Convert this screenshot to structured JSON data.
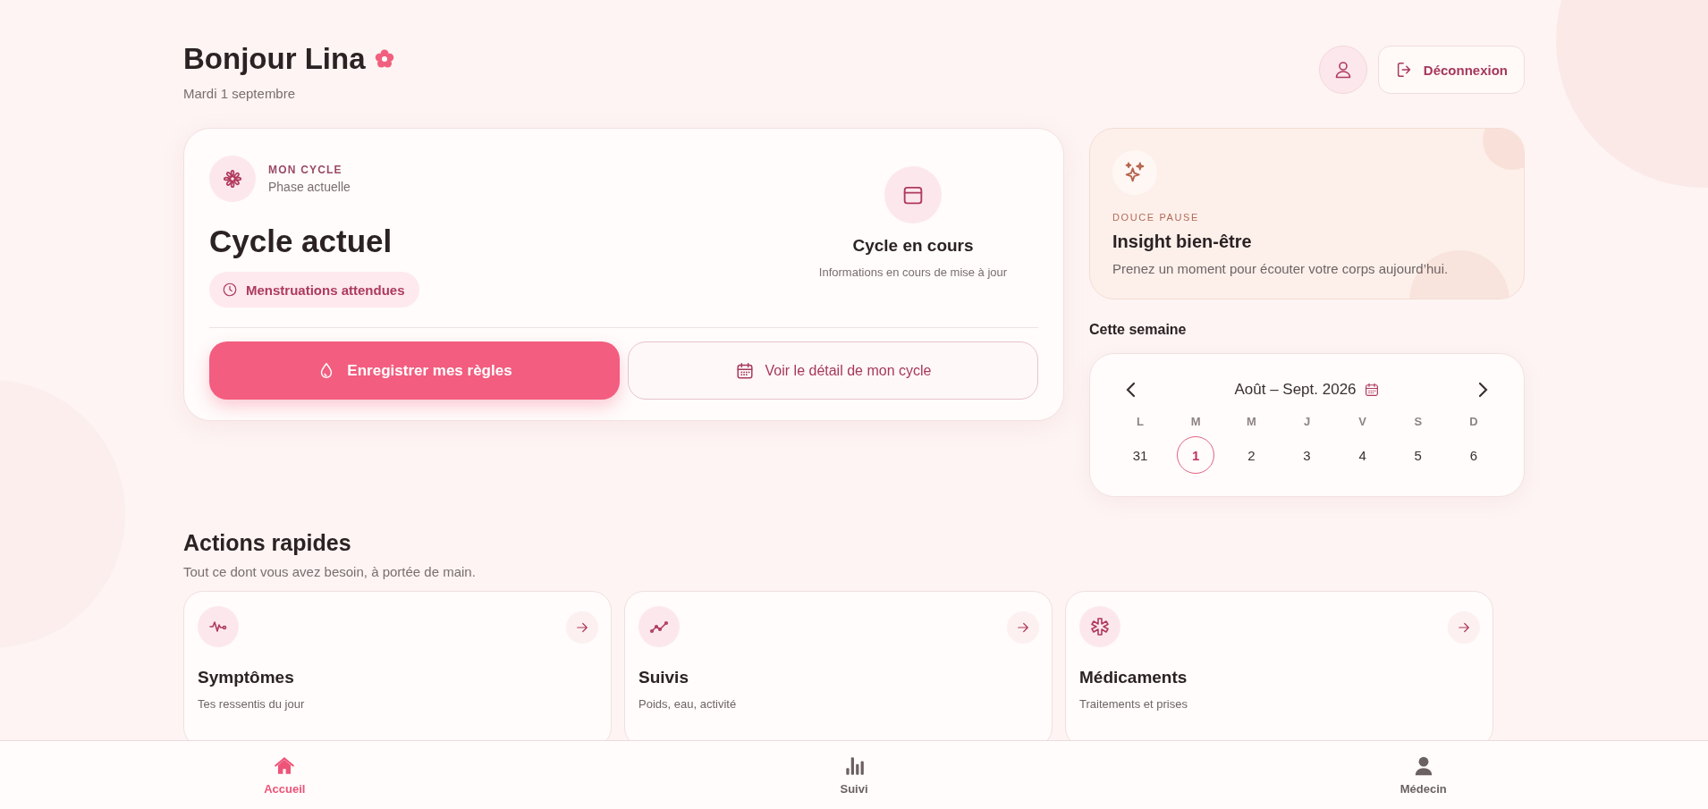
{
  "greeting": {
    "title": "Bonjour Lina",
    "date": "Mardi 1 septembre"
  },
  "account": {
    "logout": "Déconnexion"
  },
  "cycle": {
    "eyebrow": "MON CYCLE",
    "subtitle": "Phase actuelle",
    "title": "Cycle actuel",
    "badge": "Menstruations attendues",
    "status_title": "Cycle en cours",
    "status_text": "Informations en cours de mise à jour",
    "primary_button": "Enregistrer mes règles",
    "secondary_button": "Voir le détail de mon cycle"
  },
  "insight": {
    "eyebrow": "DOUCE PAUSE",
    "title": "Insight bien-être",
    "text": "Prenez un moment pour écouter votre corps aujourd’hui."
  },
  "week": {
    "heading": "Cette semaine",
    "range": "Août – Sept. 2026",
    "days": [
      {
        "letter": "L",
        "date": "31",
        "selected": false
      },
      {
        "letter": "M",
        "date": "1",
        "selected": true
      },
      {
        "letter": "M",
        "date": "2",
        "selected": false
      },
      {
        "letter": "J",
        "date": "3",
        "selected": false
      },
      {
        "letter": "V",
        "date": "4",
        "selected": false
      },
      {
        "letter": "S",
        "date": "5",
        "selected": false
      },
      {
        "letter": "D",
        "date": "6",
        "selected": false
      }
    ]
  },
  "quick_actions": {
    "title": "Actions rapides",
    "subtitle": "Tout ce dont vous avez besoin, à portée de main.",
    "items": [
      {
        "kind": "pulse",
        "title": "Symptômes",
        "text": "Tes ressentis du jour"
      },
      {
        "kind": "trend",
        "title": "Suivis",
        "text": "Poids, eau, activité"
      },
      {
        "kind": "medical",
        "title": "Médicaments",
        "text": "Traitements et prises"
      }
    ]
  },
  "bottom_nav": [
    {
      "kind": "home",
      "label": "Accueil",
      "selected": true
    },
    {
      "kind": "stats",
      "label": "Suivi",
      "selected": false
    },
    {
      "kind": "person",
      "label": "Médecin",
      "selected": false
    }
  ]
}
